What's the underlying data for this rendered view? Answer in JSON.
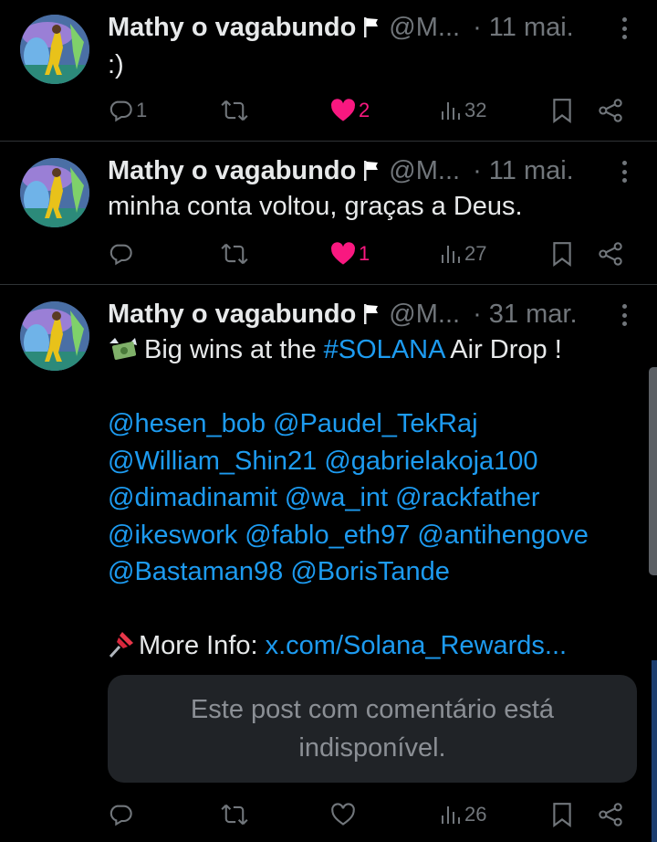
{
  "colors": {
    "background": "#000000",
    "text": "#e7e9ea",
    "muted": "#71767b",
    "link": "#1d9bf0",
    "like": "#f91880"
  },
  "posts": [
    {
      "author": "Mathy o vagabundo",
      "handle": "@M...",
      "time": "· 11 mai.",
      "text": ":)",
      "replies": "1",
      "reposts": "",
      "likes": "2",
      "liked": true,
      "views": "32"
    },
    {
      "author": "Mathy o vagabundo",
      "handle": "@M...",
      "time": "· 11 mai.",
      "text": "minha conta voltou, graças a Deus.",
      "replies": "",
      "reposts": "",
      "likes": "1",
      "liked": true,
      "views": "27"
    },
    {
      "author": "Mathy o vagabundo",
      "handle": "@M...",
      "time": "· 31 mar.",
      "text_before": "Big wins at the ",
      "hashtag": "#SOLANA",
      "text_after": " Air Drop !",
      "mentions": [
        "@hesen_bob @Paudel_TekRaj",
        "@William_Shin21 @gabrielakoja100",
        "@dimadinamit @wa_int @rackfather",
        "@ikeswork @fablo_eth97 @antihengove",
        "@Bastaman98 @BorisTande"
      ],
      "more_info_label": "More Info: ",
      "more_info_link": "x.com/Solana_Rewards...",
      "quote_unavailable": "Este post com comentário está indisponível.",
      "replies": "",
      "reposts": "",
      "likes": "",
      "liked": false,
      "views": "26"
    }
  ],
  "icons": {
    "reply": "reply-icon",
    "repost": "repost-icon",
    "like": "heart-icon",
    "views": "views-icon",
    "bookmark": "bookmark-icon",
    "share": "share-icon",
    "more": "more-icon",
    "flag": "white-flag-icon",
    "money": "money-with-wings-emoji",
    "pin": "pushpin-emoji"
  }
}
